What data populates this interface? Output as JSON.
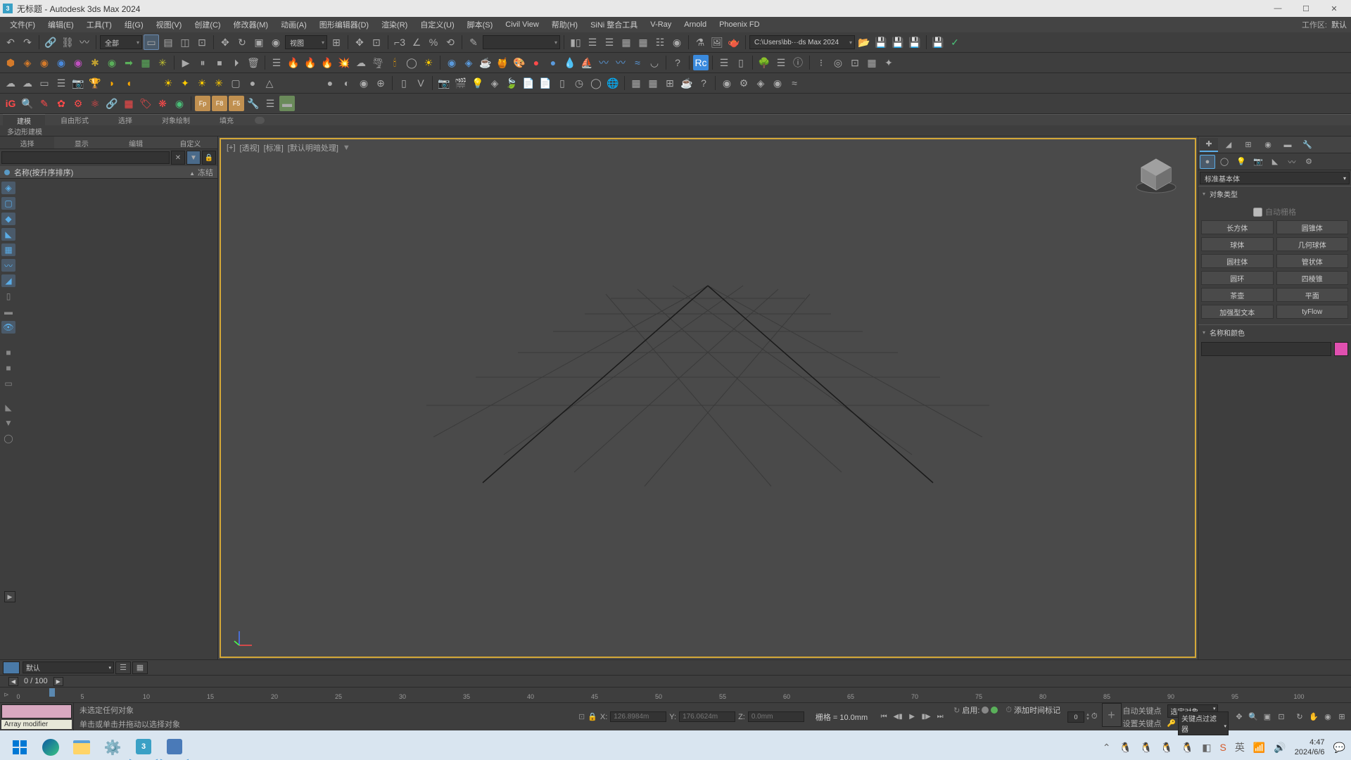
{
  "title": "无标题 - Autodesk 3ds Max 2024",
  "menubar": {
    "items": [
      "文件(F)",
      "编辑(E)",
      "工具(T)",
      "组(G)",
      "视图(V)",
      "创建(C)",
      "修改器(M)",
      "动画(A)",
      "图形编辑器(D)",
      "渲染(R)",
      "自定义(U)",
      "脚本(S)",
      "Civil View",
      "帮助(H)",
      "SiNi 整合工具",
      "V-Ray",
      "Arnold",
      "Phoenix FD"
    ],
    "workspace_label": "工作区:",
    "workspace_value": "默认"
  },
  "toolbar1": {
    "dropdown_selset": "全部",
    "dropdown_view": "视图",
    "path_field": "C:\\Users\\bb···ds Max 2024"
  },
  "ribbon": {
    "tabs": [
      "建模",
      "自由形式",
      "选择",
      "对象绘制",
      "填充"
    ],
    "sublabel": "多边形建模"
  },
  "leftpanel": {
    "tabs": [
      "选择",
      "显示",
      "编辑",
      "自定义"
    ],
    "header_name": "名称(按升序排序)",
    "header_frozen": "冻结"
  },
  "viewport": {
    "labels": [
      "[+]",
      "[透视]",
      "[标准]",
      "[默认明暗处理]"
    ]
  },
  "rightpanel": {
    "category": "标准基本体",
    "section1": "对象类型",
    "autogrid": "自动栅格",
    "buttons": [
      [
        "长方体",
        "圆锥体"
      ],
      [
        "球体",
        "几何球体"
      ],
      [
        "圆柱体",
        "管状体"
      ],
      [
        "圆环",
        "四棱锥"
      ],
      [
        "茶壶",
        "平面"
      ],
      [
        "加强型文本",
        "tyFlow"
      ]
    ],
    "section2": "名称和颜色"
  },
  "bottomstrip": {
    "layer": "默认"
  },
  "timeline": {
    "frame_display": "0  / 100",
    "coord_x": "126.8984m",
    "coord_y": "176.0624m",
    "coord_z": "0.0mm",
    "grid": "栅格 = 10.0mm",
    "enable_label": "启用:",
    "addtime_label": "添加时间标记",
    "spinner": "0",
    "autokey_label": "自动关键点",
    "autokey_dd": "选定对象",
    "setkey_label": "设置关键点",
    "keyfilter": "关键点过滤器"
  },
  "status": {
    "modifier": "Array modifier",
    "line1": "未选定任何对象",
    "line2": "单击或单击并拖动以选择对象"
  },
  "taskbar": {
    "time": "4:47",
    "date": "2024/6/6"
  }
}
